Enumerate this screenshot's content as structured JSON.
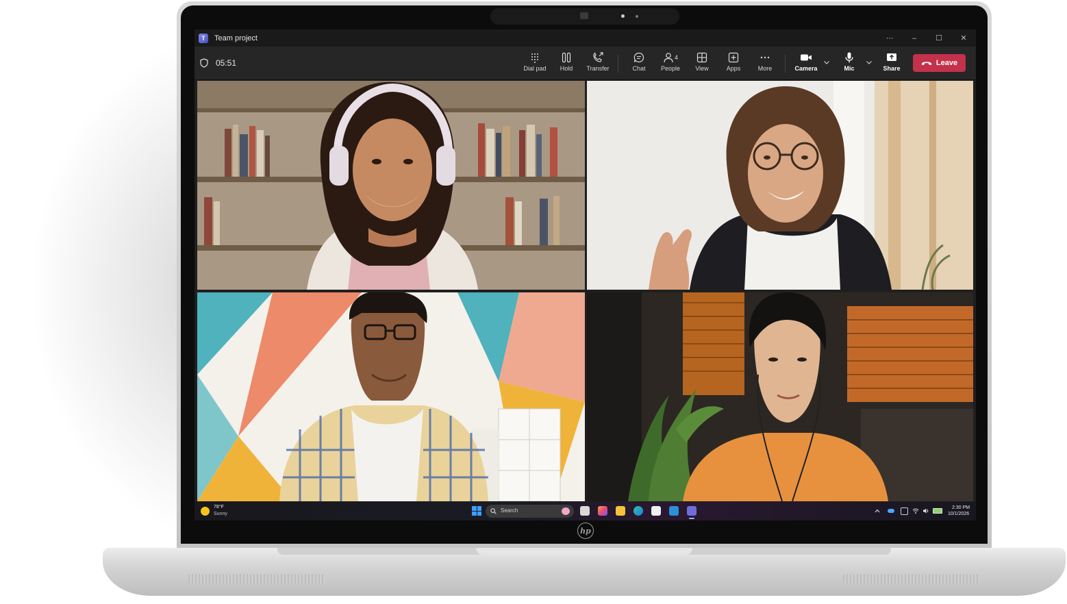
{
  "window": {
    "title": "Team project"
  },
  "call": {
    "timer": "05:51"
  },
  "toolbar": {
    "dialpad": "Dial pad",
    "hold": "Hold",
    "transfer": "Transfer",
    "chat": "Chat",
    "people": "People",
    "people_count": "4",
    "view": "View",
    "apps": "Apps",
    "more": "More",
    "camera": "Camera",
    "mic": "Mic",
    "share": "Share",
    "leave": "Leave",
    "leave_color": "#c4314b"
  },
  "participants": [
    {
      "tile": "top-left",
      "scene": "woman-headphones-bookshelf"
    },
    {
      "tile": "top-right",
      "scene": "woman-glasses-waving"
    },
    {
      "tile": "bottom-left",
      "scene": "man-glasses-plaid-shirt"
    },
    {
      "tile": "bottom-right",
      "scene": "man-orange-shirt-earphones"
    }
  ],
  "taskbar": {
    "weather_temp": "78°F",
    "weather_condition": "Sunny",
    "search_placeholder": "Search",
    "time": "2:30 PM",
    "date": "10/1/2026"
  },
  "device": {
    "brand": "hp"
  }
}
